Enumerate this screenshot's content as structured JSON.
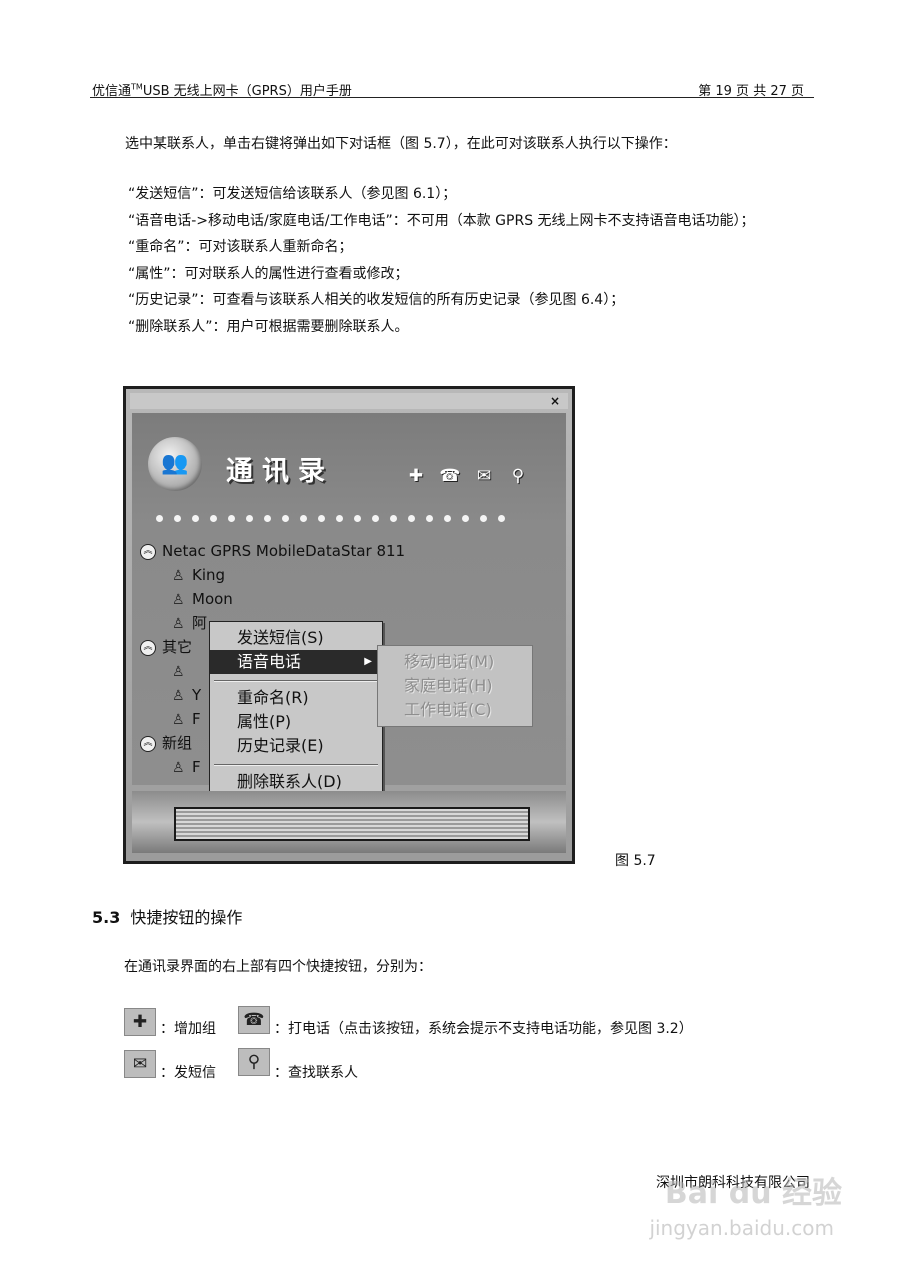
{
  "header": {
    "left_prefix": "优信通",
    "left_tm": "TM",
    "left_suffix": "USB 无线上网卡（GPRS）用户手册",
    "right": "第 19 页 共 27 页"
  },
  "intro": "选中某联系人，单击右键将弹出如下对话框（图 5.7），在此可对该联系人执行以下操作：",
  "bullets": [
    "“发送短信”：可发送短信给该联系人（参见图 6.1）；",
    "“语音电话->移动电话/家庭电话/工作电话”：不可用（本款 GPRS 无线上网卡不支持语音电话功能）；",
    "“重命名”：可对该联系人重新命名；",
    "“属性”：可对联系人的属性进行查看或修改；",
    "“历史记录”：可查看与该联系人相关的收发短信的所有历史记录（参见图 6.4）；",
    "“删除联系人”：用户可根据需要删除联系人。"
  ],
  "window": {
    "close": "×",
    "title": "通讯录",
    "toolbar_icons": [
      "add-group-icon",
      "phone-icon",
      "sms-icon",
      "search-icon"
    ],
    "groups": [
      {
        "name": "Netac GPRS MobileDataStar 811",
        "contacts": [
          "King",
          "Moon",
          "阿"
        ]
      },
      {
        "name": "其它",
        "contacts": [
          "",
          "Y",
          "F"
        ]
      },
      {
        "name": "新组",
        "contacts": [
          "F"
        ]
      }
    ],
    "menu": {
      "items": [
        "发送短信(S)",
        "语音电话",
        "重命名(R)",
        "属性(P)",
        "历史记录(E)",
        "删除联系人(D)"
      ],
      "submenu": [
        "移动电话(M)",
        "家庭电话(H)",
        "工作电话(C)"
      ]
    }
  },
  "caption": "图 5.7",
  "section": {
    "number": "5.3",
    "title": "快捷按钮的操作",
    "intro": "在通讯录界面的右上部有四个快捷按钮，分别为：",
    "quick": [
      {
        "label": "：增加组"
      },
      {
        "label": "：打电话（点击该按钮，系统会提示不支持电话功能，参见图 3.2）"
      },
      {
        "label": "：发短信"
      },
      {
        "label": "：查找联系人"
      }
    ]
  },
  "footer": {
    "company": "深圳市朗科科技有限公司",
    "watermark": "Bai du 经验",
    "watermark_url": "jingyan.baidu.com"
  }
}
